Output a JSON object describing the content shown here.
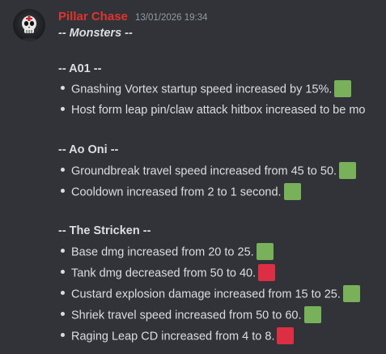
{
  "message": {
    "author": "Pillar Chase",
    "timestamp": "13/01/2026 19:34",
    "title": "-- Monsters --",
    "colors": {
      "author": "#e0332e",
      "positive": "#78b159",
      "negative": "#dd2e44"
    },
    "sections": [
      {
        "heading": "-- A01 --",
        "items": [
          {
            "text": "Gnashing Vortex startup speed increased by 15%.",
            "badge": "green-square-icon"
          },
          {
            "text": "Host form leap pin/claw attack hitbox increased to be mo",
            "badge": ""
          }
        ]
      },
      {
        "heading": "-- Ao Oni --",
        "items": [
          {
            "text": "Groundbreak travel speed increased from 45 to 50.",
            "badge": "green-square-icon"
          },
          {
            "text": "Cooldown increased from 2 to 1 second.",
            "badge": "green-square-icon"
          }
        ]
      },
      {
        "heading": "-- The Stricken --",
        "items": [
          {
            "text": "Base dmg increased from 20 to 25.",
            "badge": "green-square-icon"
          },
          {
            "text": "Tank dmg decreased from 50 to 40.",
            "badge": "red-square-icon"
          },
          {
            "text": "Custard explosion damage increased from 15 to 25.",
            "badge": "green-square-icon"
          },
          {
            "text": "Shriek travel speed increased from 50 to 60.",
            "badge": "green-square-icon"
          },
          {
            "text": "Raging Leap CD increased from 4 to 8.",
            "badge": "red-square-icon"
          }
        ]
      }
    ]
  }
}
